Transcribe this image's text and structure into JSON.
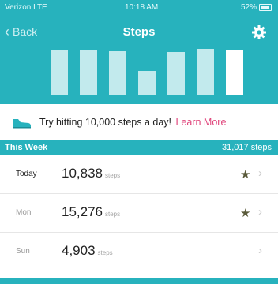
{
  "status_bar": {
    "carrier": "Verizon LTE",
    "time": "10:18 AM",
    "battery": "52%"
  },
  "nav": {
    "back_label": "Back",
    "title": "Steps",
    "settings_icon": "gear-icon"
  },
  "colors": {
    "accent": "#27b2bd",
    "link": "#e0467c"
  },
  "chart_data": {
    "type": "bar",
    "categories": [
      "",
      "",
      "",
      "",
      "",
      "",
      ""
    ],
    "values": [
      10900,
      10900,
      10500,
      5600,
      10300,
      11000,
      10838
    ],
    "highlight_index": 6
  },
  "tip": {
    "icon": "shoe-icon",
    "text": "Try hitting 10,000 steps a day!",
    "link": "Learn More"
  },
  "week": {
    "label": "This Week",
    "total": "31,017 steps"
  },
  "days": [
    {
      "day": "Today",
      "value": "10,838",
      "unit": "steps",
      "star": true
    },
    {
      "day": "Mon",
      "value": "15,276",
      "unit": "steps",
      "star": true
    },
    {
      "day": "Sun",
      "value": "4,903",
      "unit": "steps",
      "star": false
    }
  ]
}
